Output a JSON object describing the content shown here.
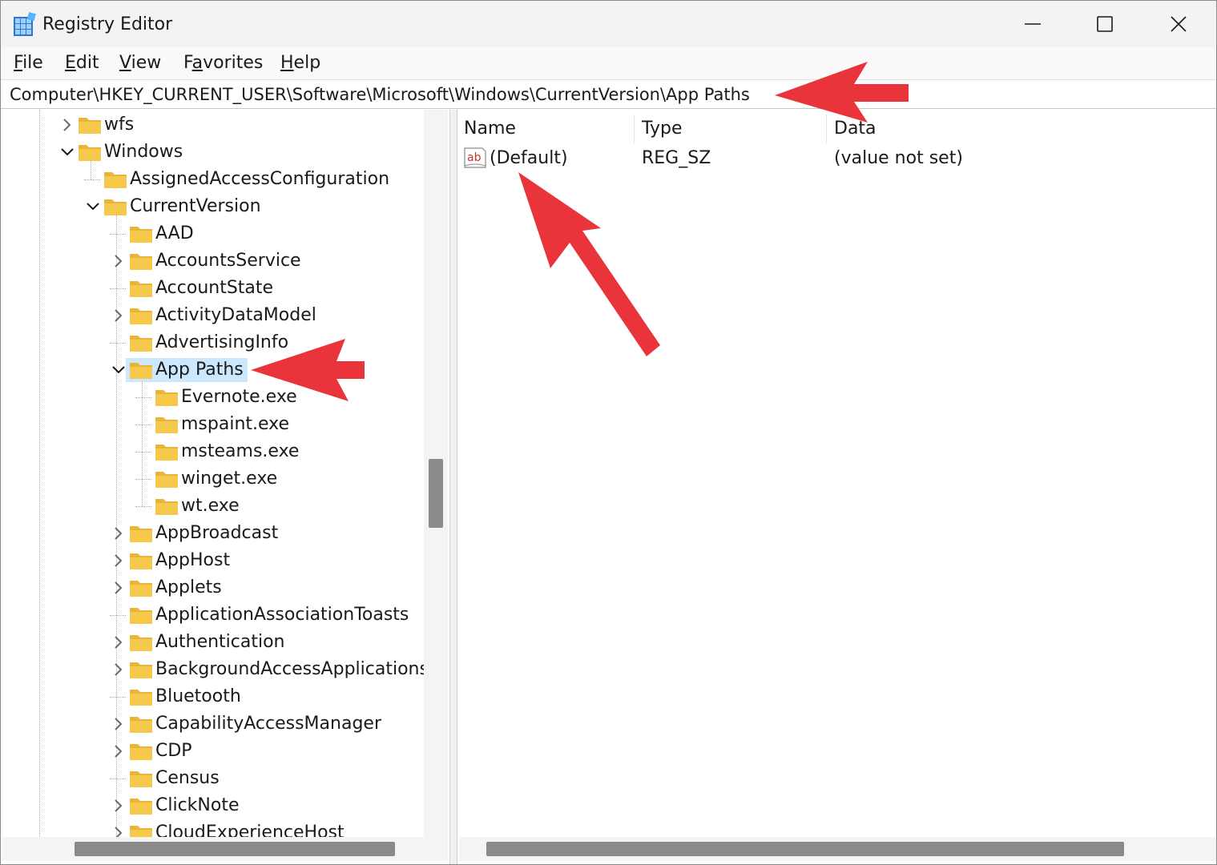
{
  "window": {
    "title": "Registry Editor"
  },
  "menu": [
    {
      "accel": "F",
      "rest": "ile"
    },
    {
      "accel": "E",
      "rest": "dit"
    },
    {
      "accel": "V",
      "rest": "iew"
    },
    {
      "accel": "",
      "pre": "F",
      "accel2": "a",
      "rest": "vorites"
    },
    {
      "accel": "H",
      "rest": "elp"
    }
  ],
  "address": {
    "value": "Computer\\HKEY_CURRENT_USER\\Software\\Microsoft\\Windows\\CurrentVersion\\App Paths"
  },
  "tree": {
    "items": [
      {
        "label": "wfs",
        "expander": "collapsed",
        "selected": false
      },
      {
        "label": "Windows",
        "expander": "expanded",
        "selected": false
      },
      {
        "label": "AssignedAccessConfiguration",
        "expander": "none",
        "selected": false
      },
      {
        "label": "CurrentVersion",
        "expander": "expanded",
        "selected": false
      },
      {
        "label": "AAD",
        "expander": "none",
        "selected": false
      },
      {
        "label": "AccountsService",
        "expander": "collapsed",
        "selected": false
      },
      {
        "label": "AccountState",
        "expander": "none",
        "selected": false
      },
      {
        "label": "ActivityDataModel",
        "expander": "collapsed",
        "selected": false
      },
      {
        "label": "AdvertisingInfo",
        "expander": "none",
        "selected": false
      },
      {
        "label": "App Paths",
        "expander": "expanded",
        "selected": true
      },
      {
        "label": "Evernote.exe",
        "expander": "none",
        "selected": false
      },
      {
        "label": "mspaint.exe",
        "expander": "none",
        "selected": false
      },
      {
        "label": "msteams.exe",
        "expander": "none",
        "selected": false
      },
      {
        "label": "winget.exe",
        "expander": "none",
        "selected": false
      },
      {
        "label": "wt.exe",
        "expander": "none",
        "selected": false
      },
      {
        "label": "AppBroadcast",
        "expander": "collapsed",
        "selected": false
      },
      {
        "label": "AppHost",
        "expander": "collapsed",
        "selected": false
      },
      {
        "label": "Applets",
        "expander": "collapsed",
        "selected": false
      },
      {
        "label": "ApplicationAssociationToasts",
        "expander": "none",
        "selected": false
      },
      {
        "label": "Authentication",
        "expander": "collapsed",
        "selected": false
      },
      {
        "label": "BackgroundAccessApplications",
        "expander": "collapsed",
        "selected": false
      },
      {
        "label": "Bluetooth",
        "expander": "none",
        "selected": false
      },
      {
        "label": "CapabilityAccessManager",
        "expander": "collapsed",
        "selected": false
      },
      {
        "label": "CDP",
        "expander": "collapsed",
        "selected": false
      },
      {
        "label": "Census",
        "expander": "none",
        "selected": false
      },
      {
        "label": "ClickNote",
        "expander": "collapsed",
        "selected": false
      },
      {
        "label": "CloudExperienceHost",
        "expander": "collapsed",
        "selected": false
      }
    ]
  },
  "list": {
    "columns": [
      "Name",
      "Type",
      "Data"
    ],
    "rows": [
      {
        "icon": "string-value-icon",
        "name": "(Default)",
        "type": "REG_SZ",
        "data": "(value not set)"
      }
    ]
  },
  "colors": {
    "selection": "#cce8ff",
    "folder": "#f6c94c",
    "arrow": "#e8343a"
  }
}
